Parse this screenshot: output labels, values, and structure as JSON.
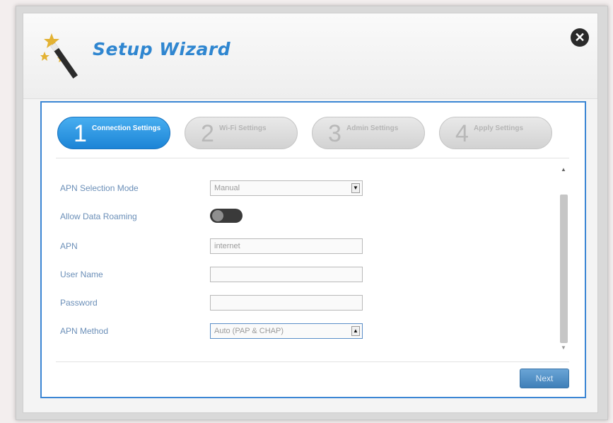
{
  "dialog": {
    "title": "Setup Wizard",
    "close_icon": "close-icon"
  },
  "steps": [
    {
      "number": "1",
      "label": "Connection Settings",
      "state": "active"
    },
    {
      "number": "2",
      "label": "Wi-Fi Settings",
      "state": "inactive"
    },
    {
      "number": "3",
      "label": "Admin Settings",
      "state": "inactive"
    },
    {
      "number": "4",
      "label": "Apply Settings",
      "state": "inactive"
    }
  ],
  "form": {
    "apn_selection_mode": {
      "label": "APN Selection Mode",
      "value": "Manual"
    },
    "allow_data_roaming": {
      "label": "Allow Data Roaming",
      "value": "off"
    },
    "apn": {
      "label": "APN",
      "value": "internet"
    },
    "user_name": {
      "label": "User Name",
      "value": ""
    },
    "password": {
      "label": "Password",
      "value": ""
    },
    "apn_method": {
      "label": "APN Method",
      "value": "Auto (PAP & CHAP)"
    }
  },
  "footer": {
    "next_label": "Next"
  },
  "colors": {
    "accent": "#2f86d0",
    "active_step": "#1c84d6",
    "panel_border": "#3b86d4"
  }
}
